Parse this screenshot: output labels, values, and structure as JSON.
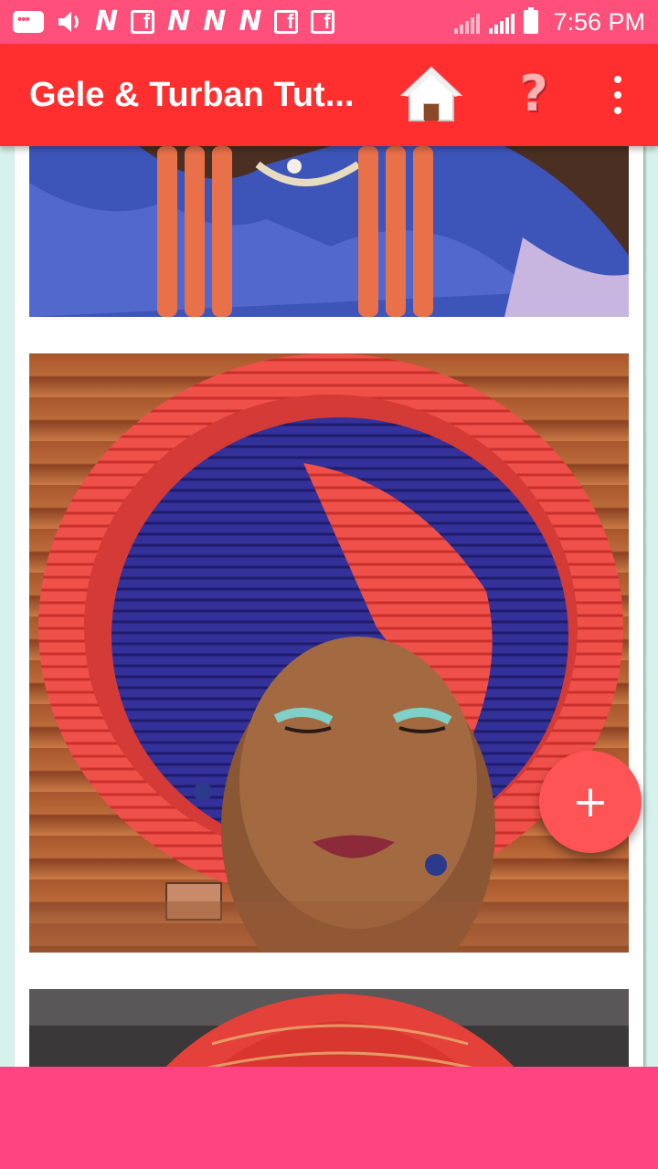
{
  "status_bar": {
    "time": "7:56 PM",
    "icons": [
      "message-icon",
      "volume-icon",
      "n-icon",
      "facebook-icon",
      "n-icon",
      "n-icon",
      "n-icon",
      "facebook-icon",
      "facebook-icon",
      "signal-icon",
      "signal-icon",
      "battery-icon"
    ]
  },
  "app_bar": {
    "title": "Gele & Turban Tut...",
    "home_icon": "home-icon",
    "help_icon": "help-icon",
    "help_glyph": "?",
    "more_icon": "more-vert-icon"
  },
  "gallery": {
    "images": [
      {
        "name": "gallery-image-1"
      },
      {
        "name": "gallery-image-2"
      },
      {
        "name": "gallery-image-3"
      }
    ]
  },
  "fab": {
    "glyph": "+",
    "icon": "add-icon"
  },
  "colors": {
    "status_bar": "#ff4f7b",
    "app_bar": "#ff2f2f",
    "background": "#d7f1ec",
    "fab": "#ff5456",
    "bottom_bar": "#ff4481"
  }
}
